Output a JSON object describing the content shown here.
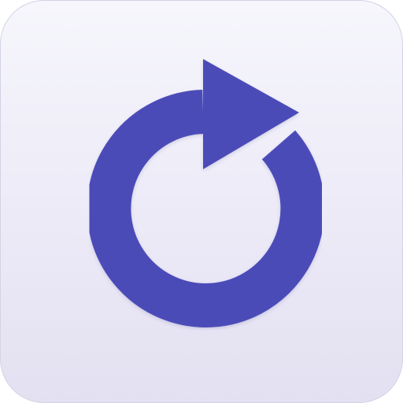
{
  "icon": {
    "name": "refresh-icon",
    "accent_color": "#4b4bb8",
    "background_top": "#f6f6fc",
    "background_bottom": "#e3e1f1"
  }
}
